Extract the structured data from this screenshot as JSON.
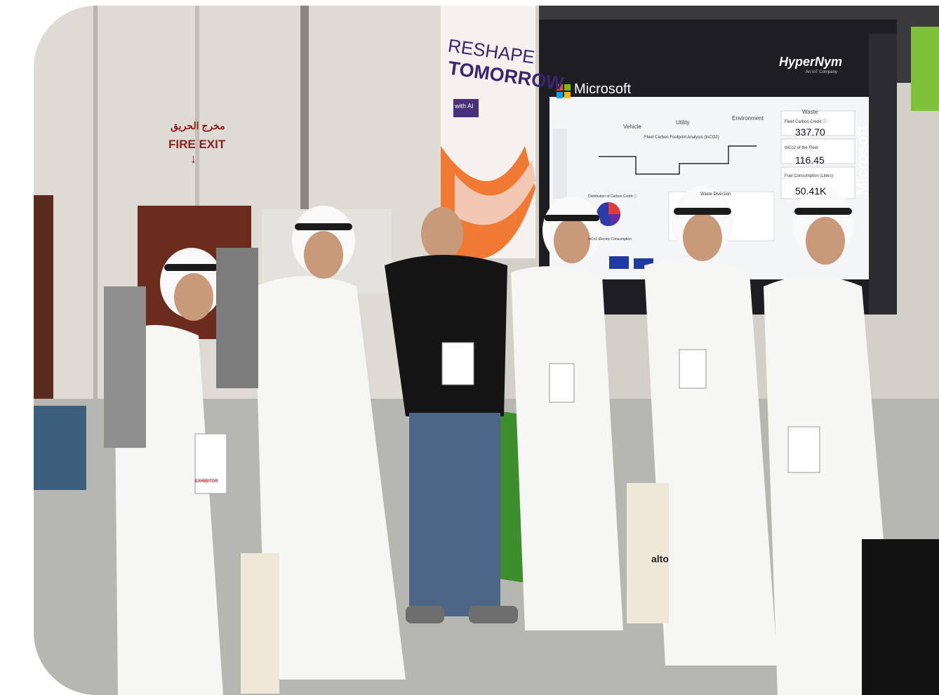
{
  "fire_exit": {
    "arabic": "مخرج الحريق",
    "english": "FIRE EXIT",
    "arrow": "↓"
  },
  "banner": {
    "line1": "RESHAPE",
    "line2": "TOMORROW",
    "tag": "with AI"
  },
  "screen": {
    "brand_left": "Microsoft",
    "brand_right": "HyperNym",
    "brand_right_sub": "An IoT Company",
    "side_vertical": "Microsoft",
    "tabs": [
      "Vehicle",
      "Utility",
      "Environment",
      "Waste"
    ],
    "chart_title": "Fleet Carbon Footprint Analysis (tnCO2)",
    "kpis": [
      {
        "label": "Fleet Carbon Credit ⓘ",
        "value": "337.70"
      },
      {
        "label": "tnCo2 of the Fleet",
        "value": "116.45"
      },
      {
        "label": "Fuel Consumption (Liters)",
        "value": "50.41K"
      }
    ],
    "panel_left_title": "Distribution of Carbon Credit ⓘ",
    "panel_mid_title": "Waste Diversion",
    "panel_bottom_title": "tnCo2 Electric Consumption"
  },
  "bag_text": "alto",
  "badge_label": "EXHIBITOR",
  "colors": {
    "ms_red": "#f25022",
    "ms_green": "#7fba00",
    "ms_blue": "#00a4ef",
    "ms_yellow": "#ffb900",
    "accent_green": "#5ab82e"
  }
}
